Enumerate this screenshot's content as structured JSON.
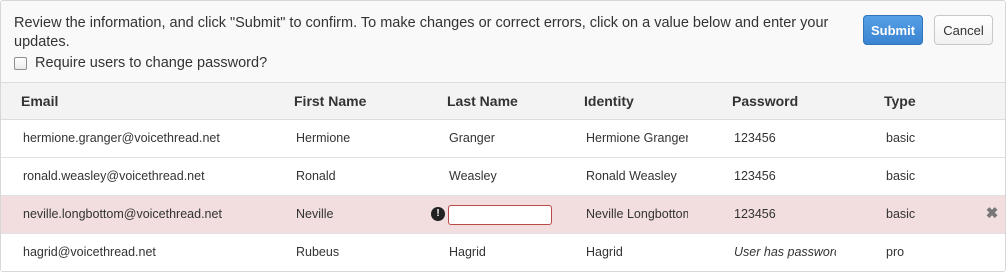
{
  "header": {
    "instructions": "Review the information, and click \"Submit\" to confirm. To make changes or correct errors, click on a value below and enter your updates.",
    "require_password_change_label": "Require users to change password?",
    "submit_label": "Submit",
    "cancel_label": "Cancel"
  },
  "table": {
    "columns": [
      "Email",
      "First Name",
      "Last Name",
      "Identity",
      "Password",
      "Type"
    ],
    "rows": [
      {
        "email": "hermione.granger@voicethread.net",
        "first_name": "Hermione",
        "last_name": "Granger",
        "identity": "Hermione Granger",
        "password": "123456",
        "type": "basic"
      },
      {
        "email": "ronald.weasley@voicethread.net",
        "first_name": "Ronald",
        "last_name": "Weasley",
        "identity": "Ronald Weasley",
        "password": "123456",
        "type": "basic"
      },
      {
        "email": "neville.longbottom@voicethread.net",
        "first_name": "Neville",
        "last_name": "",
        "identity": "Neville Longbottom",
        "password": "123456",
        "type": "basic",
        "error_icon": "!",
        "remove_icon": "✖"
      },
      {
        "email": "hagrid@voicethread.net",
        "first_name": "Rubeus",
        "last_name": "Hagrid",
        "identity": "Hagrid",
        "password": "User has password",
        "type": "pro"
      }
    ]
  },
  "colors": {
    "submit_bg": "#3a84d1",
    "error_row_bg": "#f2dede",
    "error_border": "#b94a48"
  }
}
